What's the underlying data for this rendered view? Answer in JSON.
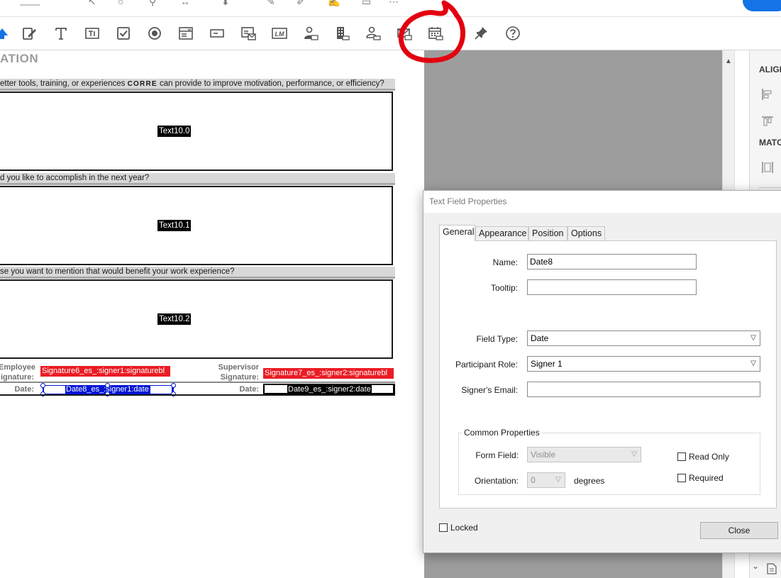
{
  "toolbar": {
    "tools": [
      {
        "name": "arrow-up-icon"
      },
      {
        "name": "edit-form-icon"
      },
      {
        "name": "text-icon"
      },
      {
        "name": "text-field-icon"
      },
      {
        "name": "checkbox-icon"
      },
      {
        "name": "radio-button-icon"
      },
      {
        "name": "list-box-icon"
      },
      {
        "name": "dropdown-icon"
      },
      {
        "name": "image-field-icon"
      },
      {
        "name": "lm-icon",
        "glyph": "LM"
      },
      {
        "name": "participant-icon"
      },
      {
        "name": "company-icon"
      },
      {
        "name": "person-field-icon"
      },
      {
        "name": "email-field-icon"
      },
      {
        "name": "date-field-icon"
      },
      {
        "name": "pin-icon"
      },
      {
        "name": "help-icon"
      }
    ]
  },
  "document": {
    "title": "ATION",
    "questions": [
      {
        "before": "etter tools, training, or experiences ",
        "brand": "CORRE",
        "after": " can provide to improve motivation, performance, or efficiency?",
        "field": "Text10.0"
      },
      {
        "before": "d you like to accomplish in the next year?",
        "brand": "",
        "after": "",
        "field": "Text10.1"
      },
      {
        "before": "se you want to mention that would benefit your work experience?",
        "brand": "",
        "after": "",
        "field": "Text10.2"
      }
    ],
    "employee_sig_label_1": "Employee",
    "employee_sig_label_2": "ignature:",
    "supervisor_sig_label_1": "Supervisor",
    "supervisor_sig_label_2": "Signature:",
    "signature6": "Signature6_es_:signer1:signaturebl",
    "signature7": "Signature7_es_:signer2:signaturebl",
    "date_label": "Date:",
    "date8": "Date8_es_:signer1:date",
    "date9": "Date9_es_:signer2:date"
  },
  "right_panel": {
    "align_header": "ALIGN",
    "match_header": "MATC"
  },
  "dialog": {
    "title": "Text Field Properties",
    "tabs": [
      "General",
      "Appearance",
      "Position",
      "Options"
    ],
    "active_tab": "General",
    "name_label": "Name:",
    "name_value": "Date8",
    "tooltip_label": "Tooltip:",
    "tooltip_value": "",
    "field_type_label": "Field Type:",
    "field_type_value": "Date",
    "participant_role_label": "Participant Role:",
    "participant_role_value": "Signer 1",
    "signer_email_label": "Signer's Email:",
    "signer_email_value": "",
    "common_properties_title": "Common Properties",
    "form_field_label": "Form Field:",
    "form_field_value": "Visible",
    "orientation_label": "Orientation:",
    "orientation_value": "0",
    "degrees_label": "degrees",
    "read_only_label": "Read Only",
    "required_label": "Required",
    "locked_label": "Locked",
    "close_label": "Close",
    "read_only_checked": false,
    "required_checked": false,
    "locked_checked": false
  },
  "colors": {
    "annotation_red": "#e3000f",
    "signature_red": "#ea1c24",
    "selection_blue": "#0015d6",
    "canvas_gray": "#9d9d9d",
    "accent_blue": "#1473e6"
  }
}
